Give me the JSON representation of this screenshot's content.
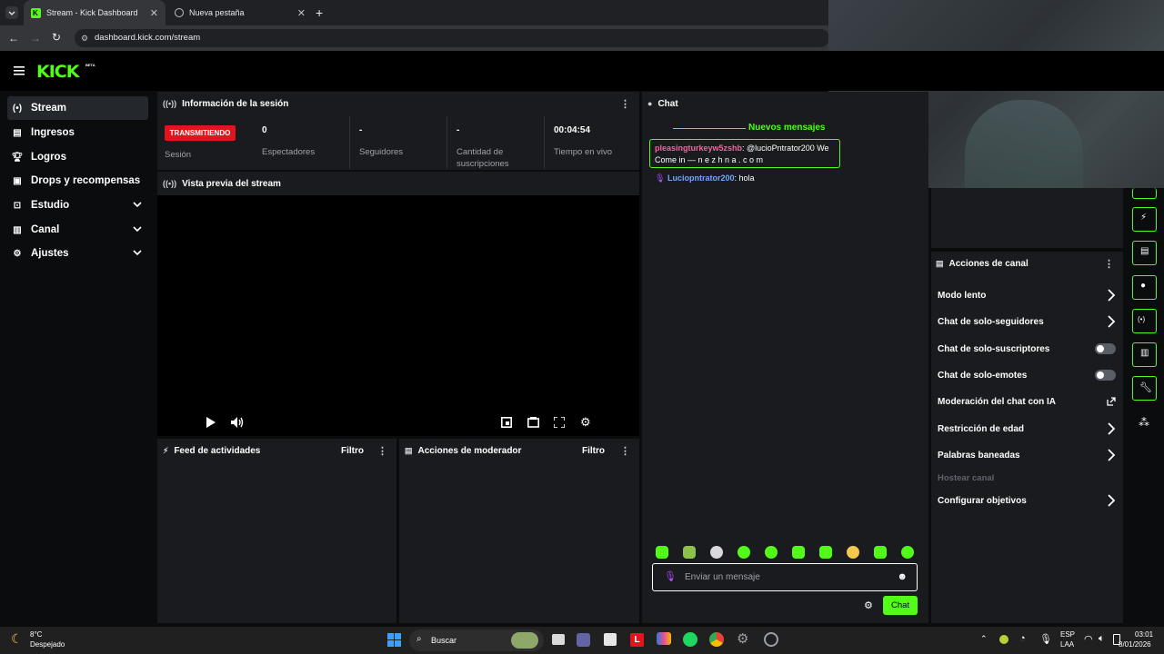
{
  "browser": {
    "tabs": [
      {
        "title": "Stream - Kick Dashboard"
      },
      {
        "title": "Nueva pestaña"
      }
    ],
    "url": "dashboard.kick.com/stream"
  },
  "brand": {
    "logo": "KICK",
    "badge": "BETA",
    "accent": "#53fc18"
  },
  "sidebar": {
    "items": [
      {
        "label": "Stream",
        "icon": "broadcast-icon"
      },
      {
        "label": "Ingresos",
        "icon": "money-icon"
      },
      {
        "label": "Logros",
        "icon": "trophy-icon"
      },
      {
        "label": "Drops y recompensas",
        "icon": "gift-icon"
      },
      {
        "label": "Estudio",
        "icon": "studio-icon"
      },
      {
        "label": "Canal",
        "icon": "channel-icon"
      },
      {
        "label": "Ajustes",
        "icon": "gear-icon"
      }
    ]
  },
  "session": {
    "title": "Información de la sesión",
    "status_badge": "TRANSMITIENDO",
    "session_label": "Sesión",
    "stats": [
      {
        "value": "0",
        "label": "Espectadores"
      },
      {
        "value": "-",
        "label": "Seguidores"
      },
      {
        "value": "-",
        "label": "Cantidad de suscripciones"
      },
      {
        "value": "00:04:54",
        "label": "Tiempo en vivo"
      }
    ]
  },
  "preview": {
    "title": "Vista previa del stream"
  },
  "activity": {
    "title": "Feed de actividades",
    "filter": "Filtro"
  },
  "moderator": {
    "title": "Acciones de moderador",
    "filter": "Filtro"
  },
  "chat": {
    "title": "Chat",
    "new_messages": "Nuevos mensajes",
    "messages": [
      {
        "user": "pleasingturkeyw5zshb",
        "text": ": @lucioPntrator200 We",
        "text2": "Come in — n e z h n a . c o m"
      },
      {
        "user": "Luciopntrator200",
        "text": ": hola"
      }
    ],
    "input_placeholder": "Enviar un mensaje",
    "send_label": "Chat"
  },
  "channel_actions": {
    "title": "Acciones de canal",
    "items": [
      {
        "label": "Modo lento",
        "control": "arrow"
      },
      {
        "label": "Chat de solo-seguidores",
        "control": "arrow"
      },
      {
        "label": "Chat de solo-suscriptores",
        "control": "toggle",
        "on": false
      },
      {
        "label": "Chat de solo-emotes",
        "control": "toggle",
        "on": false
      },
      {
        "label": "Moderación del chat con IA",
        "control": "external"
      },
      {
        "label": "Restricción de edad",
        "control": "arrow"
      },
      {
        "label": "Palabras baneadas",
        "control": "arrow"
      },
      {
        "label": "Hostear canal",
        "control": "disabled"
      },
      {
        "label": "Configurar objetivos",
        "control": "arrow"
      }
    ]
  },
  "taskbar": {
    "weather_temp": "8°C",
    "weather_desc": "Despejado",
    "search_placeholder": "Buscar",
    "lang": "ESP",
    "lang2": "LAA",
    "time": "03:01",
    "date": "8/01/2026"
  }
}
